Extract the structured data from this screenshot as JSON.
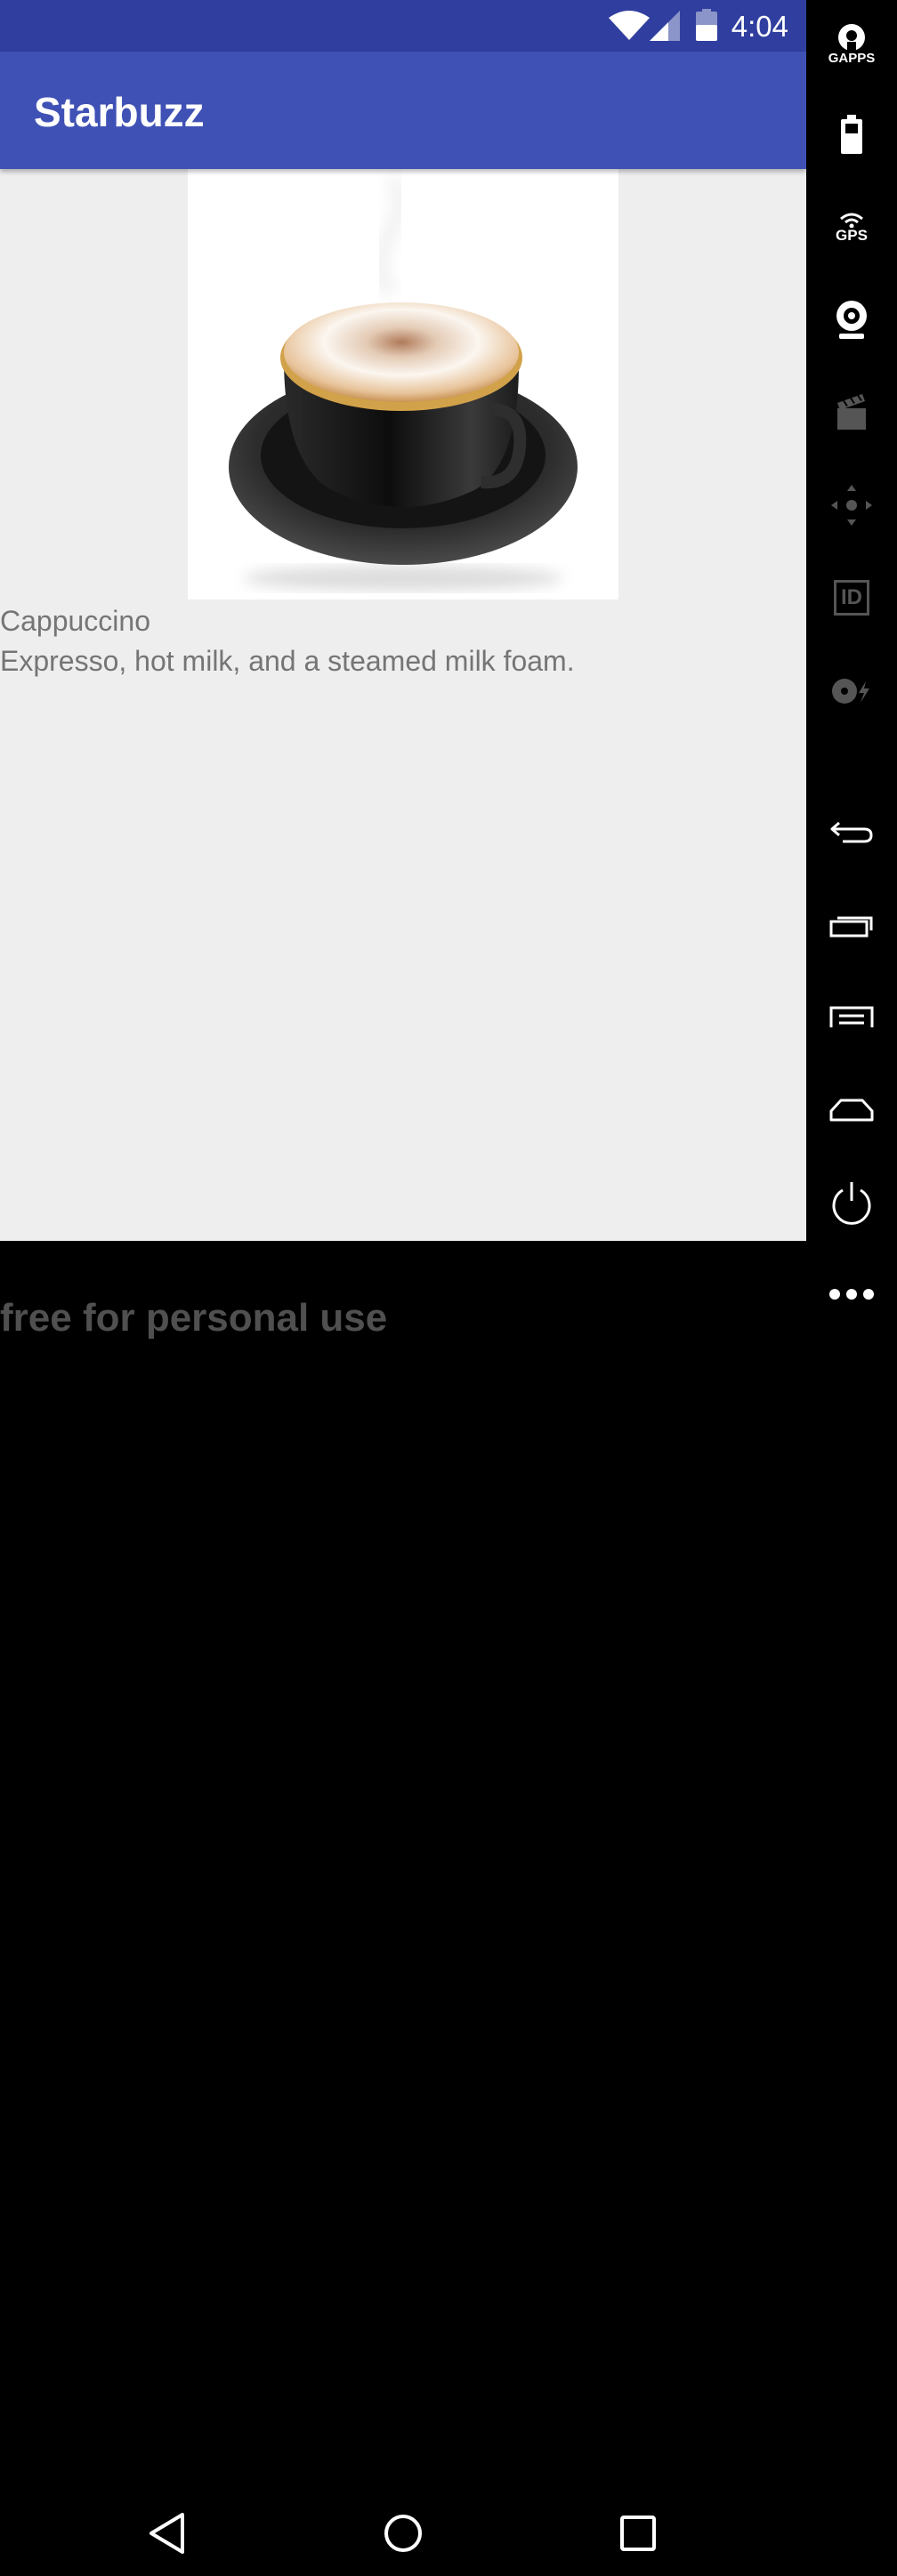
{
  "status_bar": {
    "time": "4:04"
  },
  "app_bar": {
    "title": "Starbuzz"
  },
  "drink": {
    "name": "Cappuccino",
    "description": "Expresso, hot milk, and a steamed milk foam.",
    "image_icon": "cappuccino-cup-image"
  },
  "side_panel": {
    "gapps_label": "GAPPS",
    "gps_label": "GPS",
    "id_label": "ID",
    "icons": [
      "gapps-icon",
      "battery-icon",
      "gps-icon",
      "webcam-icon",
      "clapperboard-icon",
      "dpad-icon",
      "id-icon",
      "disk-icon",
      "back-icon",
      "recent-apps-icon",
      "menu-icon",
      "home-icon",
      "power-icon",
      "more-icon"
    ]
  },
  "watermark": {
    "text": "free for personal use"
  },
  "colors": {
    "status_bar": "#303f9f",
    "app_bar": "#3f51b5",
    "background": "#eeeeee",
    "text": "#757575"
  }
}
